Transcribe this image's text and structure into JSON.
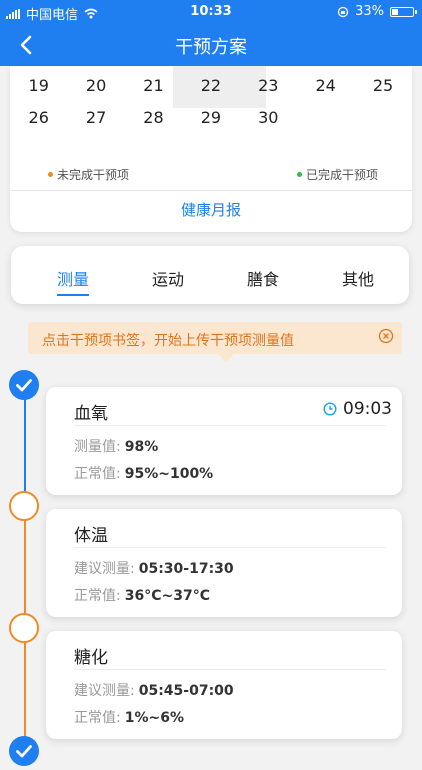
{
  "status_bar": {
    "carrier": "中国电信",
    "time": "10:33",
    "battery": "33%",
    "battery_level": 0.33
  },
  "nav": {
    "title": "干预方案"
  },
  "calendar": {
    "rows": [
      [
        "19",
        "20",
        "21",
        "22",
        "23",
        "24",
        "25"
      ],
      [
        "26",
        "27",
        "28",
        "29",
        "30",
        "",
        ""
      ]
    ],
    "legend_incomplete": "未完成干预项",
    "legend_complete": "已完成干预项",
    "legend_incomplete_color": "#f08a24",
    "legend_complete_color": "#2bbf4b",
    "report_link": "健康月报"
  },
  "tabs": [
    "测量",
    "运动",
    "膳食",
    "其他"
  ],
  "active_tab": 0,
  "tip": {
    "text": "点击干预项书签，开始上传干预项测量值"
  },
  "items": [
    {
      "name": "血氧",
      "status": "done",
      "time": "09:03",
      "rows": [
        {
          "label": "测量值:",
          "value": "98%"
        },
        {
          "label": "正常值:",
          "value": "95%~100%"
        }
      ]
    },
    {
      "name": "体温",
      "status": "todo",
      "rows": [
        {
          "label": "建议测量:",
          "value": "05:30-17:30"
        },
        {
          "label": "正常值:",
          "value": "36°C~37°C"
        }
      ]
    },
    {
      "name": "糖化",
      "status": "todo",
      "rows": [
        {
          "label": "建议测量:",
          "value": "05:45-07:00"
        },
        {
          "label": "正常值:",
          "value": "1%~6%"
        }
      ]
    }
  ],
  "colors": {
    "primary": "#1f7ff0",
    "warning": "#f08a24",
    "tip_bg": "#fbe7cf"
  }
}
